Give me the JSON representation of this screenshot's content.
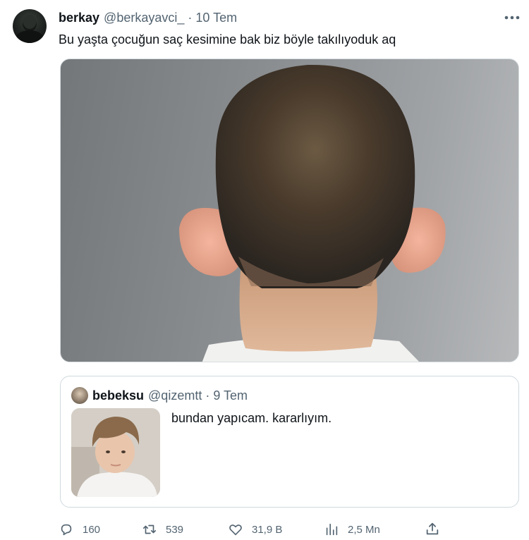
{
  "tweet": {
    "author_name": "berkay",
    "author_handle": "@berkayavci_",
    "separator": "·",
    "date": "10 Tem",
    "more_icon": "more-dots-icon",
    "text": "Bu yaşta çocuğun saç kesimine bak biz böyle takılıyoduk aq"
  },
  "quoted": {
    "author_name": "bebeksu",
    "author_handle": "@qizemtt",
    "separator": "·",
    "date": "9 Tem",
    "text": "bundan yapıcam. kararlıyım."
  },
  "actions": {
    "reply_count": "160",
    "retweet_count": "539",
    "like_count": "31,9 B",
    "views_count": "2,5 Mn",
    "icons": [
      "reply-icon",
      "retweet-icon",
      "like-icon",
      "views-icon",
      "share-icon"
    ]
  },
  "colors": {
    "text_primary": "#0f1419",
    "text_secondary": "#536471",
    "border": "#cfd9de"
  }
}
